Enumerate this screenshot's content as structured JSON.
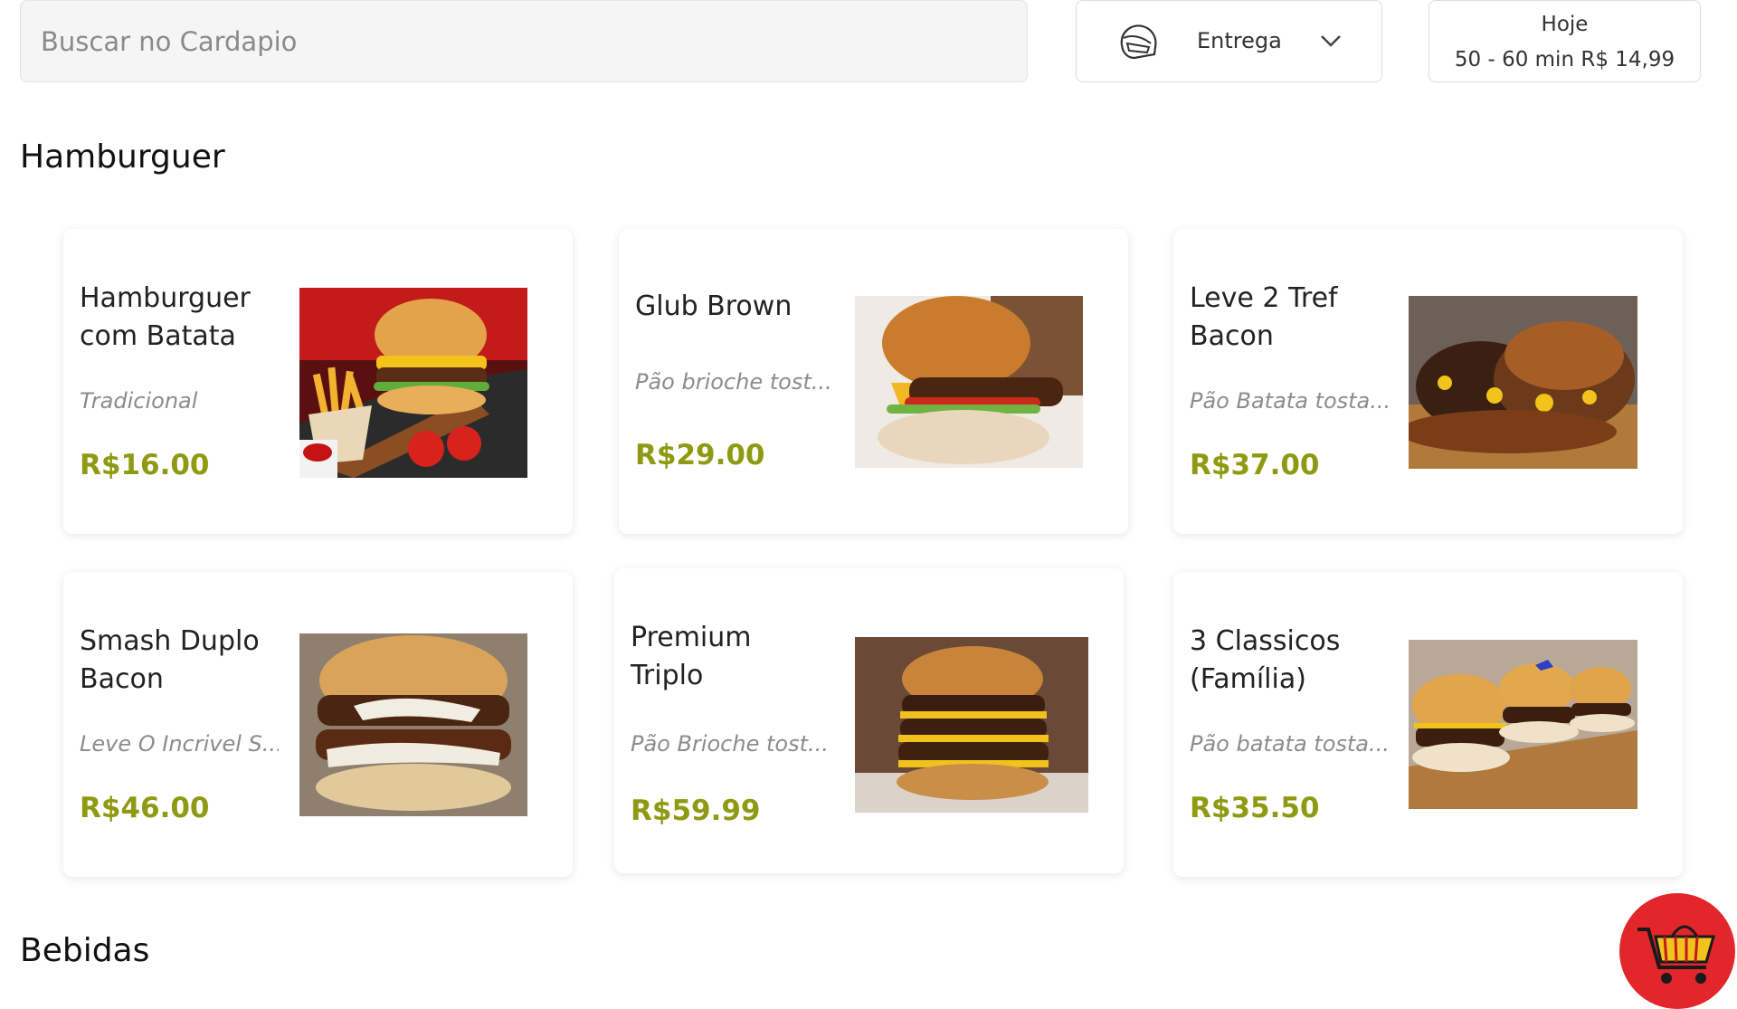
{
  "search": {
    "placeholder": "Buscar no Cardapio",
    "value": ""
  },
  "delivery": {
    "label": "Entrega",
    "icon": "helmet-icon"
  },
  "schedule": {
    "day": "Hoje",
    "info": "50 - 60 min R$ 14,99"
  },
  "sections": [
    {
      "title": "Hamburguer",
      "items": [
        {
          "name": "Hamburguer com Batata",
          "description": "Tradicional",
          "price": "R$16.00"
        },
        {
          "name": "Glub Brown",
          "description": "Pão brioche tost...",
          "price": "R$29.00"
        },
        {
          "name": "Leve 2 Tref Bacon",
          "description": "Pão Batata tosta...",
          "price": "R$37.00"
        },
        {
          "name": "Smash Duplo Bacon",
          "description": "Leve O Incrivel S...",
          "price": "R$46.00"
        },
        {
          "name": "Premium Triplo",
          "description": "Pão Brioche tost...",
          "price": "R$59.99"
        },
        {
          "name": "3 Classicos (Família)",
          "description": "Pão batata tosta...",
          "price": "R$35.50"
        }
      ]
    },
    {
      "title": "Bebidas"
    }
  ],
  "colors": {
    "price": "#8f9a12",
    "cart": "#e3262c"
  }
}
